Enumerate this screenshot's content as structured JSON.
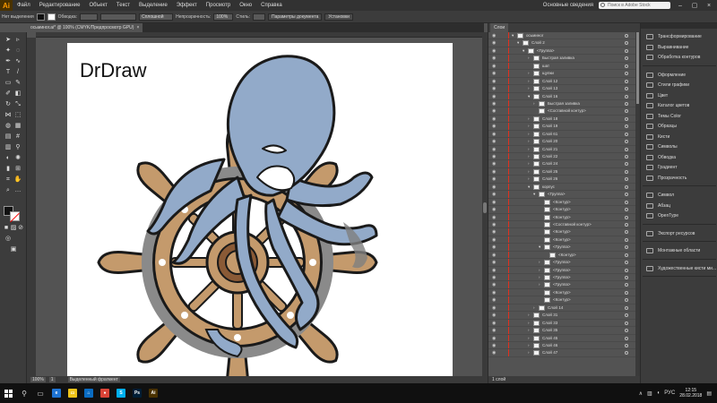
{
  "app": {
    "logo": "Ai",
    "accent": "#ff9a00"
  },
  "menubar": {
    "items": [
      "Файл",
      "Редактирование",
      "Объект",
      "Текст",
      "Выделение",
      "Эффект",
      "Просмотр",
      "Окно",
      "Справка"
    ],
    "workspace": "Основные сведения",
    "search_placeholder": "Поиск в Adobe Stock"
  },
  "control_bar": {
    "selection": "Нет выделения",
    "stroke_label": "Обводка:",
    "profile_label": "Основн.",
    "style_label": "Сплошной",
    "opacity_label": "Непрозрачность:",
    "opacity_value": "100%",
    "style2_label": "Стиль:",
    "doc_settings": "Параметры документа",
    "prefs": "Установки"
  },
  "document_tab": {
    "title": "осьминог.ai* @ 100% (CMYK/Предпросмотр GPU)",
    "close": "×"
  },
  "artwork": {
    "title": "DrDraw"
  },
  "status_bar": {
    "zoom": "100%",
    "page": "1",
    "tool": "Выделенный фрагмент"
  },
  "layers_panel": {
    "tab": "Слои",
    "footer": "1 слой",
    "rows": [
      {
        "name": "осьминог",
        "indent": 0,
        "arrow": "▾"
      },
      {
        "name": "Слой 2",
        "indent": 1,
        "arrow": "▾"
      },
      {
        "name": "<Группа>",
        "indent": 2,
        "arrow": "▾"
      },
      {
        "name": "Быстрая заливка",
        "indent": 3,
        "arrow": "›"
      },
      {
        "name": "шат",
        "indent": 3,
        "arrow": ""
      },
      {
        "name": "щупки",
        "indent": 3,
        "arrow": "›"
      },
      {
        "name": "Слой 12",
        "indent": 3,
        "arrow": "›"
      },
      {
        "name": "Слой 13",
        "indent": 3,
        "arrow": "›"
      },
      {
        "name": "Слой 16",
        "indent": 3,
        "arrow": "▾"
      },
      {
        "name": "Быстрая заливка",
        "indent": 4,
        "arrow": "›"
      },
      {
        "name": "<Составной контур>",
        "indent": 4,
        "arrow": ""
      },
      {
        "name": "Слой 18",
        "indent": 3,
        "arrow": "›"
      },
      {
        "name": "Слой 19",
        "indent": 3,
        "arrow": "›"
      },
      {
        "name": "Слой 61",
        "indent": 3,
        "arrow": "›"
      },
      {
        "name": "Слой 20",
        "indent": 3,
        "arrow": "›"
      },
      {
        "name": "Слой 21",
        "indent": 3,
        "arrow": "›"
      },
      {
        "name": "Слой 22",
        "indent": 3,
        "arrow": "›"
      },
      {
        "name": "Слой 24",
        "indent": 3,
        "arrow": "›"
      },
      {
        "name": "Слой 25",
        "indent": 3,
        "arrow": "›"
      },
      {
        "name": "Слой 26",
        "indent": 3,
        "arrow": "›"
      },
      {
        "name": "корпус",
        "indent": 3,
        "arrow": "▾"
      },
      {
        "name": "<Группа>",
        "indent": 4,
        "arrow": "▾"
      },
      {
        "name": "<Контур>",
        "indent": 5,
        "arrow": ""
      },
      {
        "name": "<Контур>",
        "indent": 5,
        "arrow": ""
      },
      {
        "name": "<Контур>",
        "indent": 5,
        "arrow": ""
      },
      {
        "name": "<Составной контур>",
        "indent": 5,
        "arrow": ""
      },
      {
        "name": "<Контур>",
        "indent": 5,
        "arrow": ""
      },
      {
        "name": "<Контур>",
        "indent": 5,
        "arrow": ""
      },
      {
        "name": "<Группа>",
        "indent": 5,
        "arrow": "▾"
      },
      {
        "name": "<Контур>",
        "indent": 6,
        "arrow": ""
      },
      {
        "name": "<Группа>",
        "indent": 5,
        "arrow": "›"
      },
      {
        "name": "<Группа>",
        "indent": 5,
        "arrow": "›"
      },
      {
        "name": "<Группа>",
        "indent": 5,
        "arrow": "›"
      },
      {
        "name": "<Группа>",
        "indent": 5,
        "arrow": "›"
      },
      {
        "name": "<Контур>",
        "indent": 5,
        "arrow": ""
      },
      {
        "name": "<Контур>",
        "indent": 5,
        "arrow": ""
      },
      {
        "name": "Слой 14",
        "indent": 4,
        "arrow": "›"
      },
      {
        "name": "Слой 31",
        "indent": 3,
        "arrow": "›"
      },
      {
        "name": "Слой 33",
        "indent": 3,
        "arrow": "›"
      },
      {
        "name": "Слой 35",
        "indent": 3,
        "arrow": "›"
      },
      {
        "name": "Слой 45",
        "indent": 3,
        "arrow": "›"
      },
      {
        "name": "Слой 46",
        "indent": 3,
        "arrow": "›"
      },
      {
        "name": "Слой 47",
        "indent": 3,
        "arrow": "›"
      }
    ]
  },
  "dock": {
    "groups": [
      [
        "Трансформирование",
        "Выравнивание",
        "Обработка контуров"
      ],
      [
        "Оформление",
        "Стили графики",
        "Цвет",
        "Каталог цветов",
        "Темы Color",
        "Образцы",
        "Кисти",
        "Символы",
        "Обводка",
        "Градиент",
        "Прозрачность"
      ],
      [
        "Символ",
        "Абзац",
        "OpenType"
      ],
      [
        "Экспорт ресурсов"
      ],
      [
        "Монтажные области"
      ],
      [
        "Художественные кисти ми..."
      ]
    ]
  },
  "taskbar": {
    "lang": "РУС",
    "time": "12:15",
    "date": "28.02.2018",
    "apps": [
      {
        "label": "e",
        "color": "#1e73d2",
        "name": "edge"
      },
      {
        "label": "▭",
        "color": "#f0c419",
        "name": "explorer"
      },
      {
        "label": "⌂",
        "color": "#0a6cc2",
        "name": "store"
      },
      {
        "label": "●",
        "color": "#db4437",
        "name": "chrome"
      },
      {
        "label": "S",
        "color": "#00aff0",
        "name": "skype"
      },
      {
        "label": "Ps",
        "color": "#001e36",
        "name": "photoshop"
      },
      {
        "label": "Ai",
        "color": "#4a3200",
        "name": "illustrator"
      }
    ]
  }
}
